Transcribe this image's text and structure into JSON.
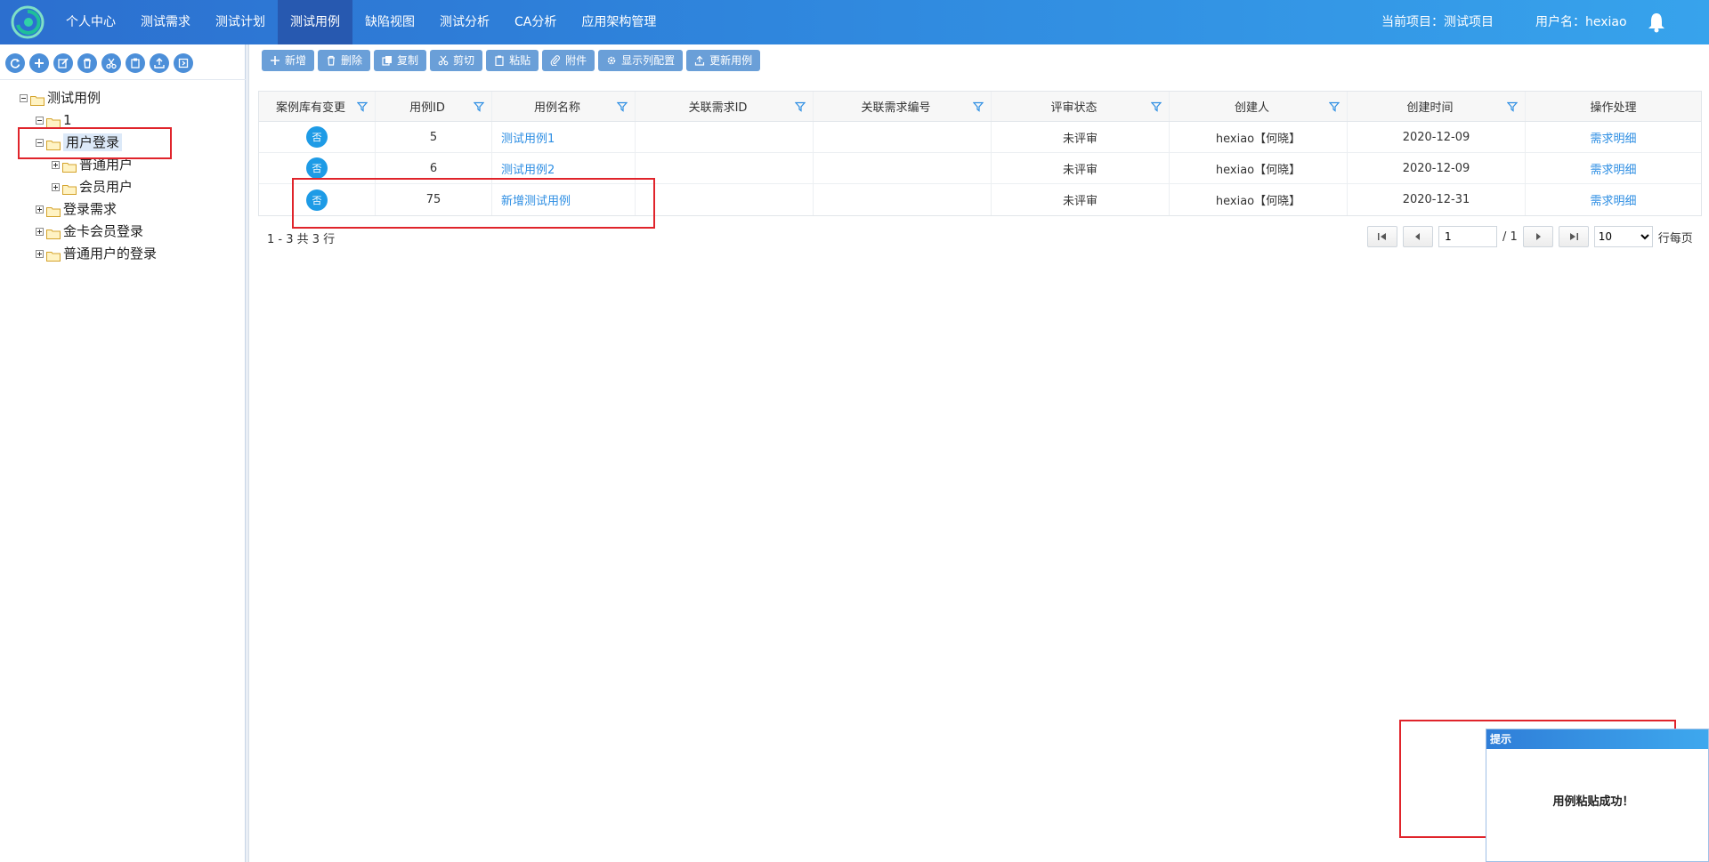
{
  "nav": {
    "items": [
      "个人中心",
      "测试需求",
      "测试计划",
      "测试用例",
      "缺陷视图",
      "测试分析",
      "CA分析",
      "应用架构管理"
    ],
    "active_index": 3,
    "current_project": "当前项目：测试项目",
    "username": "用户名：hexiao"
  },
  "tree": {
    "tools": [
      "refresh-icon",
      "plus-icon",
      "edit-icon",
      "trash-icon",
      "scissors-icon",
      "paste-icon",
      "upload-icon",
      "export-icon"
    ],
    "nodes": [
      "测试用例",
      "1",
      "用户登录",
      "普通用户",
      "会员用户",
      "登录需求",
      "金卡会员登录",
      "普通用户的登录"
    ]
  },
  "toolbar": {
    "add": "新增",
    "delete": "删除",
    "copy": "复制",
    "cut": "剪切",
    "paste": "粘贴",
    "attach": "附件",
    "columns": "显示列配置",
    "update": "更新用例"
  },
  "table": {
    "headers": [
      "案例库有变更",
      "用例ID",
      "用例名称",
      "关联需求ID",
      "关联需求编号",
      "评审状态",
      "创建人",
      "创建时间",
      "操作处理"
    ],
    "rows": [
      {
        "changed": "否",
        "id": "5",
        "name": "测试用例1",
        "req_id": "",
        "req_no": "",
        "review": "未评审",
        "creator": "hexiao【何晓】",
        "created": "2020-12-09",
        "action": "需求明细"
      },
      {
        "changed": "否",
        "id": "6",
        "name": "测试用例2",
        "req_id": "",
        "req_no": "",
        "review": "未评审",
        "creator": "hexiao【何晓】",
        "created": "2020-12-09",
        "action": "需求明细"
      },
      {
        "changed": "否",
        "id": "75",
        "name": "新增测试用例",
        "req_id": "",
        "req_no": "",
        "review": "未评审",
        "creator": "hexiao【何晓】",
        "created": "2020-12-31",
        "action": "需求明细"
      }
    ]
  },
  "pager": {
    "info": "1 - 3 共 3 行",
    "page": "1",
    "total": "/ 1",
    "size": "10",
    "per_page": "行每页"
  },
  "toast": {
    "title": "提示",
    "message": "用例粘贴成功！"
  },
  "colors": {
    "nav_start": "#2c6fcf",
    "nav_end": "#37a3ec",
    "nav_active": "#2759b0",
    "link": "#2d8ee3",
    "highlight": "#e0242b",
    "badge": "#1e9be6"
  }
}
